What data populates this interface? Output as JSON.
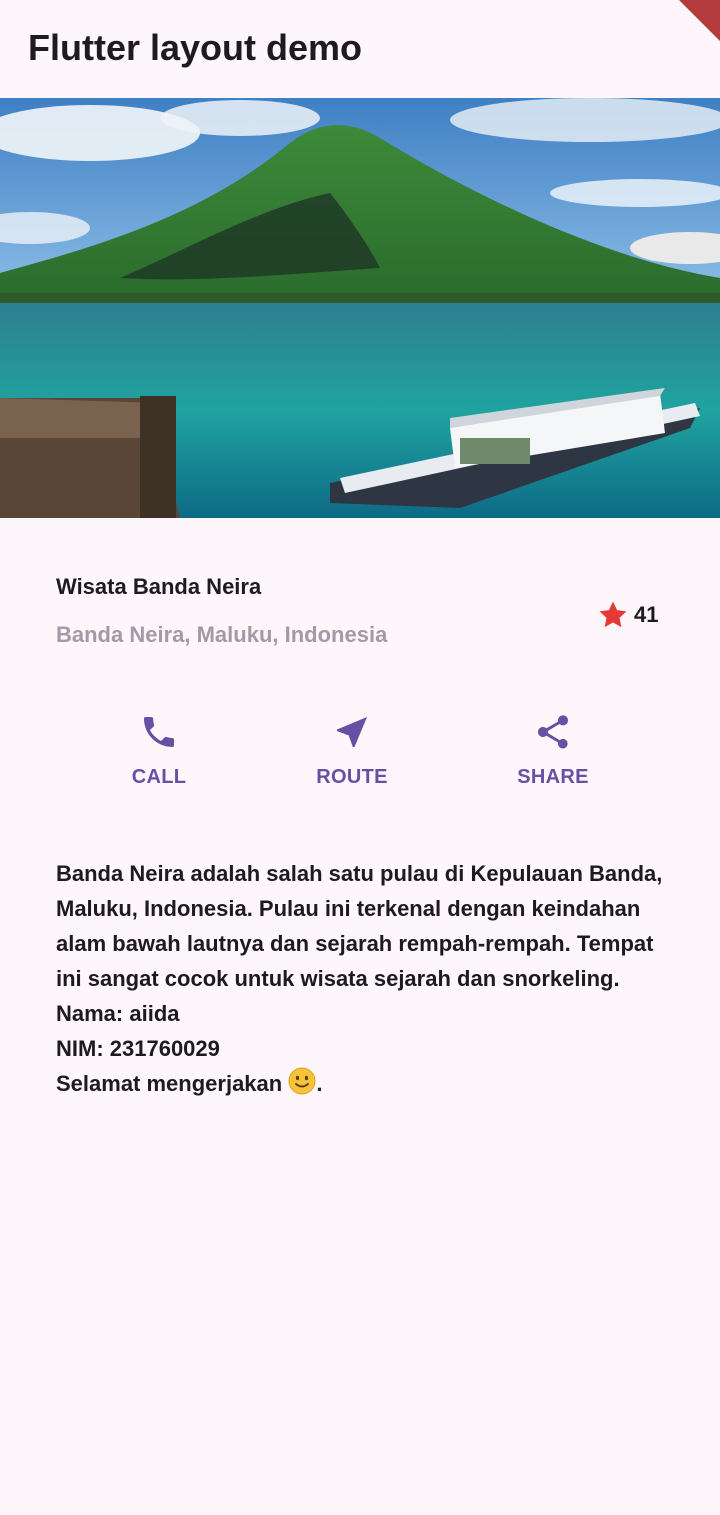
{
  "app_bar": {
    "title": "Flutter layout demo",
    "debug_banner": "DEBUG"
  },
  "hero_image": {
    "icon": "island-photo"
  },
  "title_section": {
    "name": "Wisata Banda Neira",
    "location": "Banda Neira, Maluku, Indonesia",
    "rating": {
      "icon": "star-icon",
      "count": "41",
      "color": "#e53935"
    }
  },
  "actions": [
    {
      "label": "CALL",
      "icon": "phone-icon"
    },
    {
      "label": "ROUTE",
      "icon": "navigation-icon"
    },
    {
      "label": "SHARE",
      "icon": "share-icon"
    }
  ],
  "description": {
    "paragraph": "Banda Neira adalah salah satu pulau di Kepulauan Banda, Maluku, Indonesia. Pulau ini terkenal dengan keindahan alam bawah lautnya dan sejarah rempah-rempah. Tempat ini sangat cocok untuk wisata sejarah dan snorkeling. Nama: aiida",
    "nim": "NIM: 231760029",
    "closing": "Selamat mengerjakan",
    "closing_suffix": ".",
    "emoji": "slightly-smiling-face"
  },
  "colors": {
    "background": "#fdf7fc",
    "accent": "#6750a4",
    "secondary_text": "#a29aa6"
  }
}
